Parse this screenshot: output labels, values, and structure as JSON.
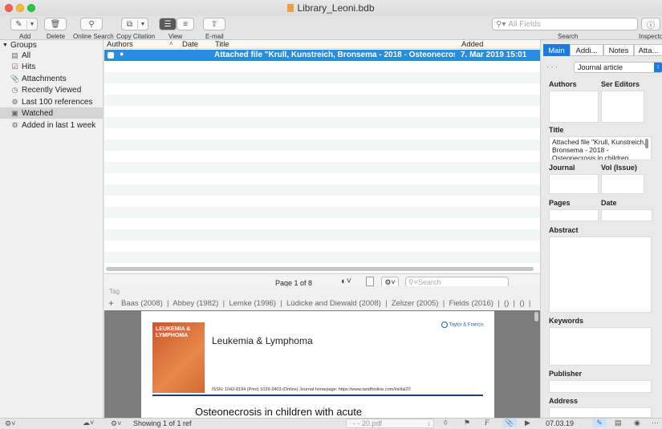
{
  "window": {
    "title": "Library_Leoni.bdb"
  },
  "toolbar": {
    "add": "Add",
    "delete": "Delete",
    "online_search": "Online Search",
    "copy_citation": "Copy Citation",
    "view": "View",
    "email": "E-mail",
    "search_placeholder": "All Fields",
    "search": "Search",
    "inspector": "Inspecto"
  },
  "sidebar": {
    "header": "Groups",
    "items": [
      {
        "label": "All",
        "icon": "library-icon"
      },
      {
        "label": "Hits",
        "icon": "checkbox-icon"
      },
      {
        "label": "Attachments",
        "icon": "paperclip-icon"
      },
      {
        "label": "Recently Viewed",
        "icon": "clock-icon"
      },
      {
        "label": "Last 100 references",
        "icon": "gear-icon"
      },
      {
        "label": "Watched",
        "icon": "folder-icon"
      },
      {
        "label": "Added in last 1 week",
        "icon": "gear-icon"
      }
    ]
  },
  "list": {
    "columns": {
      "authors": "Authors",
      "date": "Date",
      "title": "Title",
      "added": "Added"
    },
    "selected_row": {
      "title": "Attached file \"Krull, Kunstreich, Bronsema - 2018 - Osteonecrosis in childre",
      "added": "7. Mar 2019 15:01"
    }
  },
  "pager": {
    "text": "Page 1 of 8",
    "search_placeholder": "Search"
  },
  "tags": {
    "label": "Tag",
    "items": [
      "Baas (2008)",
      "Abbey (1982)",
      "Lemke (1996)",
      "Lüdicke and Diewald (2008)",
      "Zelizer (2005)",
      "Fields (2016)",
      "()",
      "()"
    ]
  },
  "pdf": {
    "cover_title": "LEUKEMIA & LYMPHOMA",
    "journal": "Leukemia & Lymphoma",
    "publisher": "Taylor & Francis",
    "issn": "ISSN: 1042-8194 (Print) 1029-2403 (Online) Journal homepage: https://www.tandfonline.com/loi/ilal20",
    "heading": "Osteonecrosis in children with acute"
  },
  "inspector": {
    "tabs": [
      "Main",
      "Addi...",
      "Notes",
      "Atta..."
    ],
    "type": "Journal article",
    "labels": {
      "authors": "Authors",
      "ser_editors": "Ser Editors",
      "title": "Title",
      "journal": "Journal",
      "vol": "Vol (Issue)",
      "pages": "Pages",
      "date": "Date",
      "abstract": "Abstract",
      "keywords": "Keywords",
      "publisher": "Publisher",
      "address": "Address"
    },
    "title_value": "Attached file \"Krull, Kunstreich, Bronsema - 2018 - Osteonecrosis in children"
  },
  "status": {
    "showing": "Showing 1 of 1 ref",
    "file": "- - 20.pdf",
    "date": "07.03.19"
  },
  "colors": {
    "selection": "#2a8ce0",
    "accent": "#1d7be0"
  }
}
